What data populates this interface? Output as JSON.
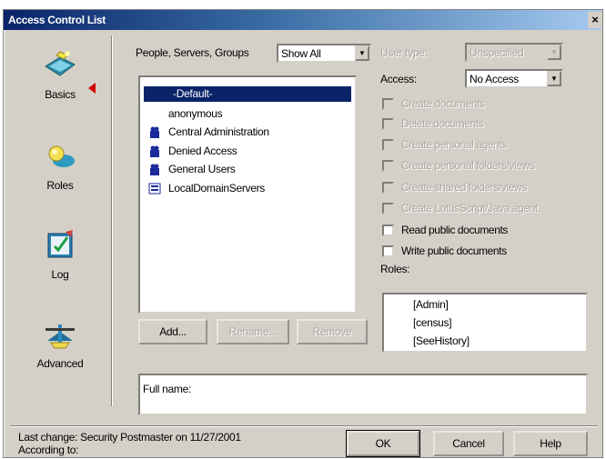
{
  "window": {
    "title": "Access Control List",
    "close_glyph": "×"
  },
  "nav": {
    "items": [
      {
        "label": "Basics",
        "icon": "basics-icon"
      },
      {
        "label": "Roles",
        "icon": "roles-icon"
      },
      {
        "label": "Log",
        "icon": "log-icon"
      },
      {
        "label": "Advanced",
        "icon": "advanced-icon"
      }
    ],
    "selected": "Basics"
  },
  "filter": {
    "label": "People, Servers, Groups",
    "value": "Show All"
  },
  "entries": [
    {
      "name": "-Default-",
      "icon": "none",
      "selected": true
    },
    {
      "name": "anonymous",
      "icon": "none",
      "selected": false
    },
    {
      "name": "Central Administration",
      "icon": "group-icon",
      "selected": false
    },
    {
      "name": "Denied Access",
      "icon": "group-icon",
      "selected": false
    },
    {
      "name": "General Users",
      "icon": "group-icon",
      "selected": false
    },
    {
      "name": "LocalDomainServers",
      "icon": "server-group-icon",
      "selected": false
    }
  ],
  "buttons": {
    "add": "Add...",
    "rename": "Rename...",
    "remove": "Remove"
  },
  "user_type": {
    "label": "User type:",
    "value": "Unspecified",
    "enabled": false
  },
  "access": {
    "label": "Access:",
    "value": "No Access"
  },
  "permissions": [
    {
      "label": "Create documents",
      "enabled": false,
      "checked": false
    },
    {
      "label": "Delete documents",
      "enabled": false,
      "checked": false
    },
    {
      "label": "Create personal agents",
      "enabled": false,
      "checked": false
    },
    {
      "label": "Create personal folders/views",
      "enabled": false,
      "checked": false
    },
    {
      "label": "Create shared folders/views",
      "enabled": false,
      "checked": false
    },
    {
      "label": "Create LotusScript/Java agent",
      "enabled": false,
      "checked": false
    },
    {
      "label": "Read public documents",
      "enabled": true,
      "checked": false
    },
    {
      "label": "Write public documents",
      "enabled": true,
      "checked": false
    }
  ],
  "roles": {
    "label": "Roles:",
    "items": [
      "[Admin]",
      "[census]",
      "[SeeHistory]"
    ]
  },
  "full_name": {
    "label": "Full name:"
  },
  "footer": {
    "last_change": "Last change: Security Postmaster on 11/27/2001",
    "according_to": "According to:",
    "ok": "OK",
    "cancel": "Cancel",
    "help": "Help"
  },
  "colors": {
    "selection": "#0a246a",
    "face": "#d4d0c8",
    "red_arrow": "#d00000"
  }
}
